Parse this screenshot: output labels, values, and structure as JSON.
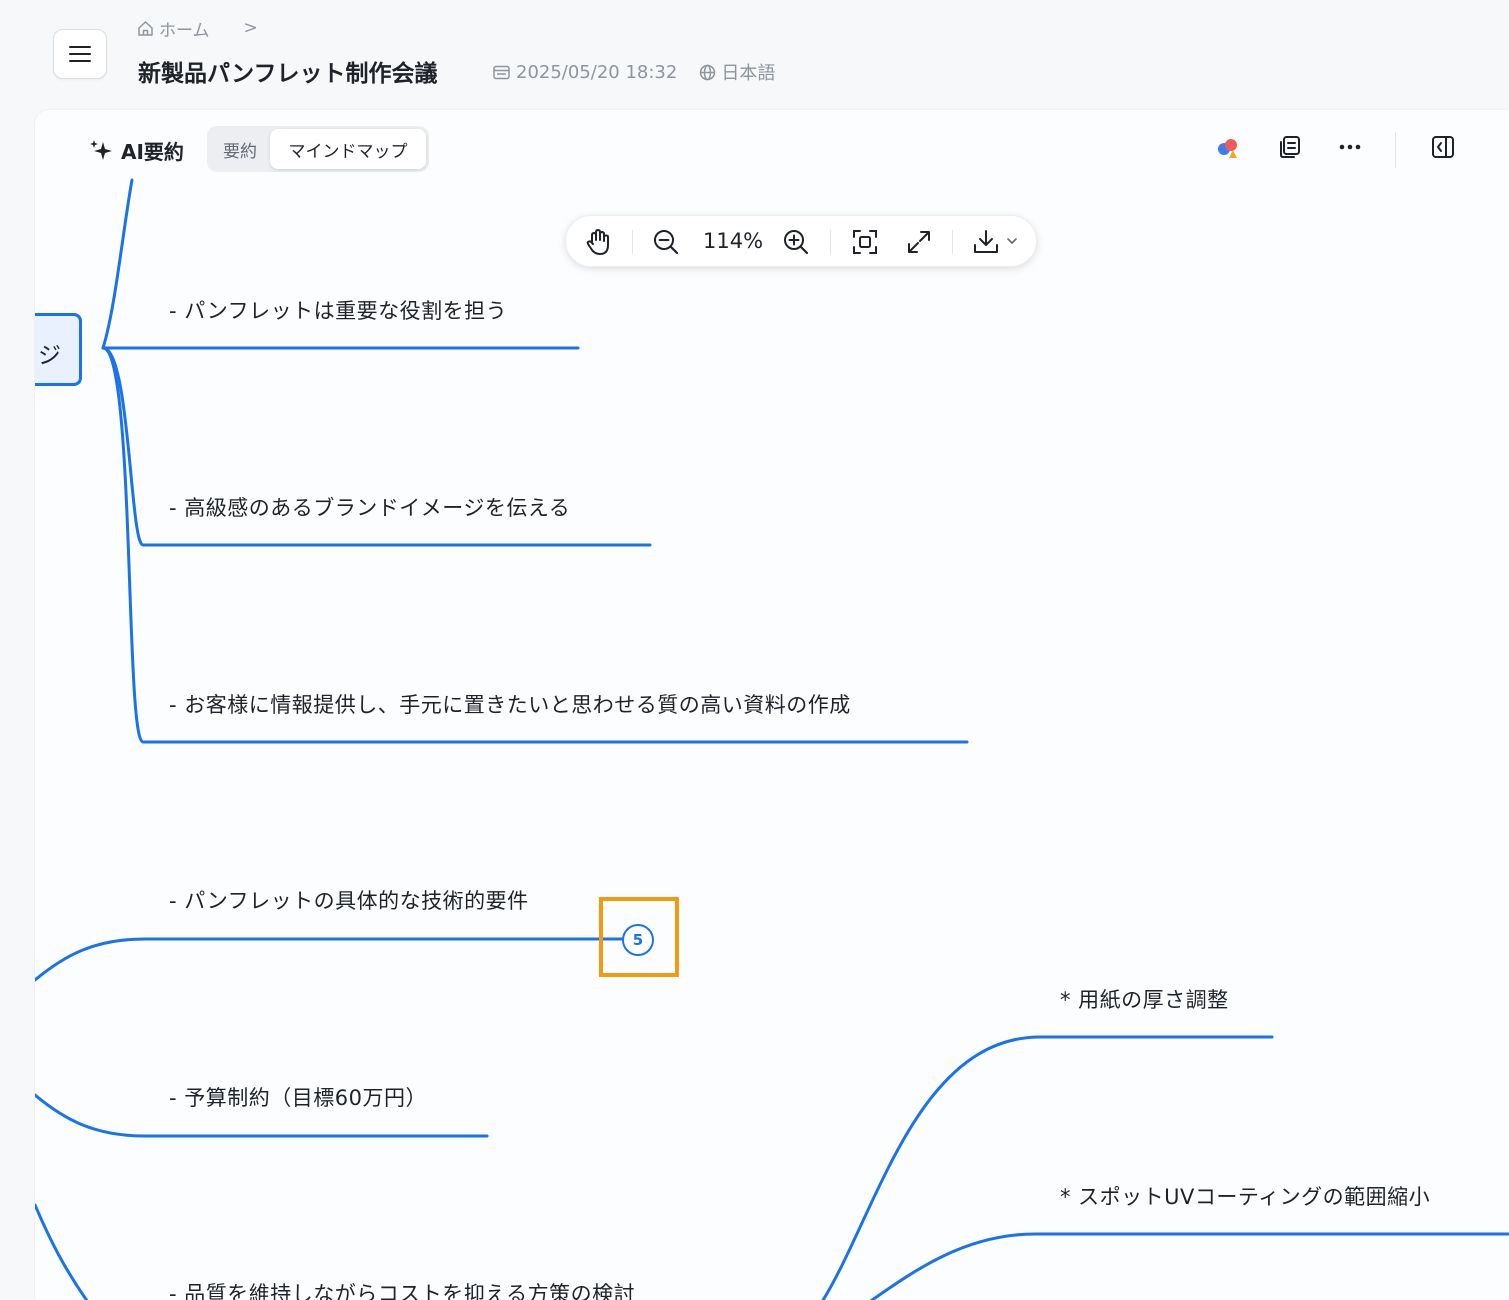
{
  "header": {
    "breadcrumb_home": "ホーム",
    "breadcrumb_sep": ">",
    "title": "新製品パンフレット制作会議",
    "datetime": "2025/05/20 18:32",
    "language": "日本語"
  },
  "panel": {
    "ai_title": "AI要約",
    "tabs": [
      "要約",
      "マインドマップ"
    ],
    "active_tab": "マインドマップ"
  },
  "zoom": {
    "level": "114%"
  },
  "mindmap": {
    "root_label": "ジ",
    "nodes": [
      "- パンフレットは重要な役割を担う",
      "- 高級感のあるブランドイメージを伝える",
      "- お客様に情報提供し、手元に置きたいと思わせる質の高い資料の作成",
      "- パンフレットの具体的な技術的要件",
      "- 予算制約（目標60万円）",
      "- 品質を維持しながらコストを抑える方策の検討",
      "* 用紙の厚さ調整",
      "* スポットUVコーティングの範囲縮小"
    ],
    "collapsed_count": "5"
  },
  "colors": {
    "accent": "#1a73e8",
    "highlight": "#f59a0e"
  }
}
